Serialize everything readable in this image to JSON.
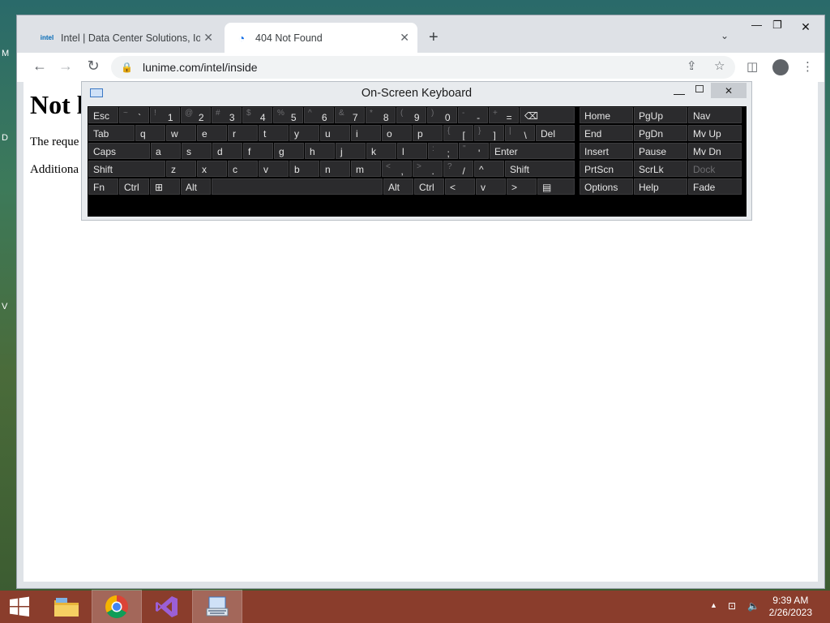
{
  "desktop": {
    "edge_letters": [
      "M",
      "D",
      "V"
    ]
  },
  "browser": {
    "tabs": [
      {
        "favicon": "intel",
        "title": "Intel | Data Center Solutions, IoT"
      },
      {
        "favicon": "edge-icon",
        "title": "404 Not Found"
      }
    ],
    "new_tab_label": "+",
    "address": "lunime.com/intel/inside"
  },
  "page": {
    "heading": "Not l",
    "line1": "The reque",
    "line2": "Additiona"
  },
  "osk": {
    "title": "On-Screen Keyboard",
    "keys": {
      "esc": "Esc",
      "tab": "Tab",
      "caps": "Caps",
      "shift_l": "Shift",
      "fn": "Fn",
      "ctrl_l": "Ctrl",
      "alt_l": "Alt",
      "alt_r": "Alt",
      "ctrl_r": "Ctrl",
      "del": "Del",
      "enter": "Enter",
      "shift_r": "Shift",
      "home": "Home",
      "pgup": "PgUp",
      "nav": "Nav",
      "end": "End",
      "pgdn": "PgDn",
      "mvup": "Mv Up",
      "insert": "Insert",
      "pause": "Pause",
      "mvdn": "Mv Dn",
      "prtscn": "PrtScn",
      "scrlk": "ScrLk",
      "dock": "Dock",
      "options": "Options",
      "help": "Help",
      "fade": "Fade",
      "left": "<",
      "down": "v",
      "right": ">",
      "up": "^",
      "num_row": [
        {
          "alt": "~",
          "main": "`"
        },
        {
          "alt": "!",
          "main": "1"
        },
        {
          "alt": "@",
          "main": "2"
        },
        {
          "alt": "#",
          "main": "3"
        },
        {
          "alt": "$",
          "main": "4"
        },
        {
          "alt": "%",
          "main": "5"
        },
        {
          "alt": "^",
          "main": "6"
        },
        {
          "alt": "&",
          "main": "7"
        },
        {
          "alt": "*",
          "main": "8"
        },
        {
          "alt": "(",
          "main": "9"
        },
        {
          "alt": ")",
          "main": "0"
        },
        {
          "alt": "-",
          "main": "-"
        },
        {
          "alt": "+",
          "main": "="
        }
      ],
      "q_row": [
        "q",
        "w",
        "e",
        "r",
        "t",
        "y",
        "u",
        "i",
        "o",
        "p"
      ],
      "q_sym": [
        {
          "alt": "{",
          "main": "["
        },
        {
          "alt": "}",
          "main": "]"
        },
        {
          "alt": "|",
          "main": "\\"
        }
      ],
      "a_row": [
        "a",
        "s",
        "d",
        "f",
        "g",
        "h",
        "j",
        "k",
        "l"
      ],
      "a_sym": [
        {
          "alt": ":",
          "main": ";"
        },
        {
          "alt": "\"",
          "main": "'"
        }
      ],
      "z_row": [
        "z",
        "x",
        "c",
        "v",
        "b",
        "n",
        "m"
      ],
      "z_sym": [
        {
          "alt": "<",
          "main": ","
        },
        {
          "alt": ">",
          "main": "."
        },
        {
          "alt": "?",
          "main": "/"
        }
      ]
    }
  },
  "taskbar": {
    "time": "9:39 AM",
    "date": "2/26/2023",
    "accent": "#8a3d2c"
  }
}
